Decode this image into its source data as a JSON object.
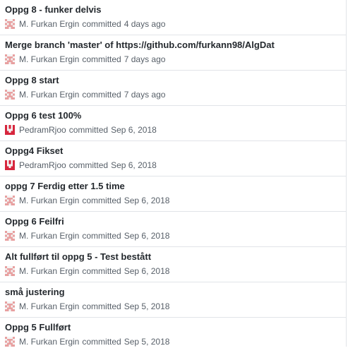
{
  "commits": [
    {
      "title": "Oppg 8 - funker delvis",
      "author": "M. Furkan Ergin",
      "verb": "committed",
      "date": "4 days ago",
      "avatar": "identicon-pink"
    },
    {
      "title": "Merge branch 'master' of https://github.com/furkann98/AlgDat",
      "author": "M. Furkan Ergin",
      "verb": "committed",
      "date": "7 days ago",
      "avatar": "identicon-pink"
    },
    {
      "title": "Oppg 8 start",
      "author": "M. Furkan Ergin",
      "verb": "committed",
      "date": "7 days ago",
      "avatar": "identicon-pink"
    },
    {
      "title": "Oppg 6 test 100%",
      "author": "PedramRjoo",
      "verb": "committed",
      "date": "Sep 6, 2018",
      "avatar": "identicon-red"
    },
    {
      "title": "Oppg4 Fikset",
      "author": "PedramRjoo",
      "verb": "committed",
      "date": "Sep 6, 2018",
      "avatar": "identicon-red"
    },
    {
      "title": "oppg 7 Ferdig etter 1.5 time",
      "author": "M. Furkan Ergin",
      "verb": "committed",
      "date": "Sep 6, 2018",
      "avatar": "identicon-pink"
    },
    {
      "title": "Oppg 6 Feilfri",
      "author": "M. Furkan Ergin",
      "verb": "committed",
      "date": "Sep 6, 2018",
      "avatar": "identicon-pink"
    },
    {
      "title": "Alt fullført til oppg 5 - Test bestått",
      "author": "M. Furkan Ergin",
      "verb": "committed",
      "date": "Sep 6, 2018",
      "avatar": "identicon-pink"
    },
    {
      "title": "små justering",
      "author": "M. Furkan Ergin",
      "verb": "committed",
      "date": "Sep 5, 2018",
      "avatar": "identicon-pink"
    },
    {
      "title": "Oppg 5 Fullført",
      "author": "M. Furkan Ergin",
      "verb": "committed",
      "date": "Sep 5, 2018",
      "avatar": "identicon-pink"
    }
  ],
  "colors": {
    "title": "#24292e",
    "meta": "#586069",
    "border": "#e1e4e8",
    "avatar_pink": "#e8a0a0",
    "avatar_red": "#d7263d"
  }
}
